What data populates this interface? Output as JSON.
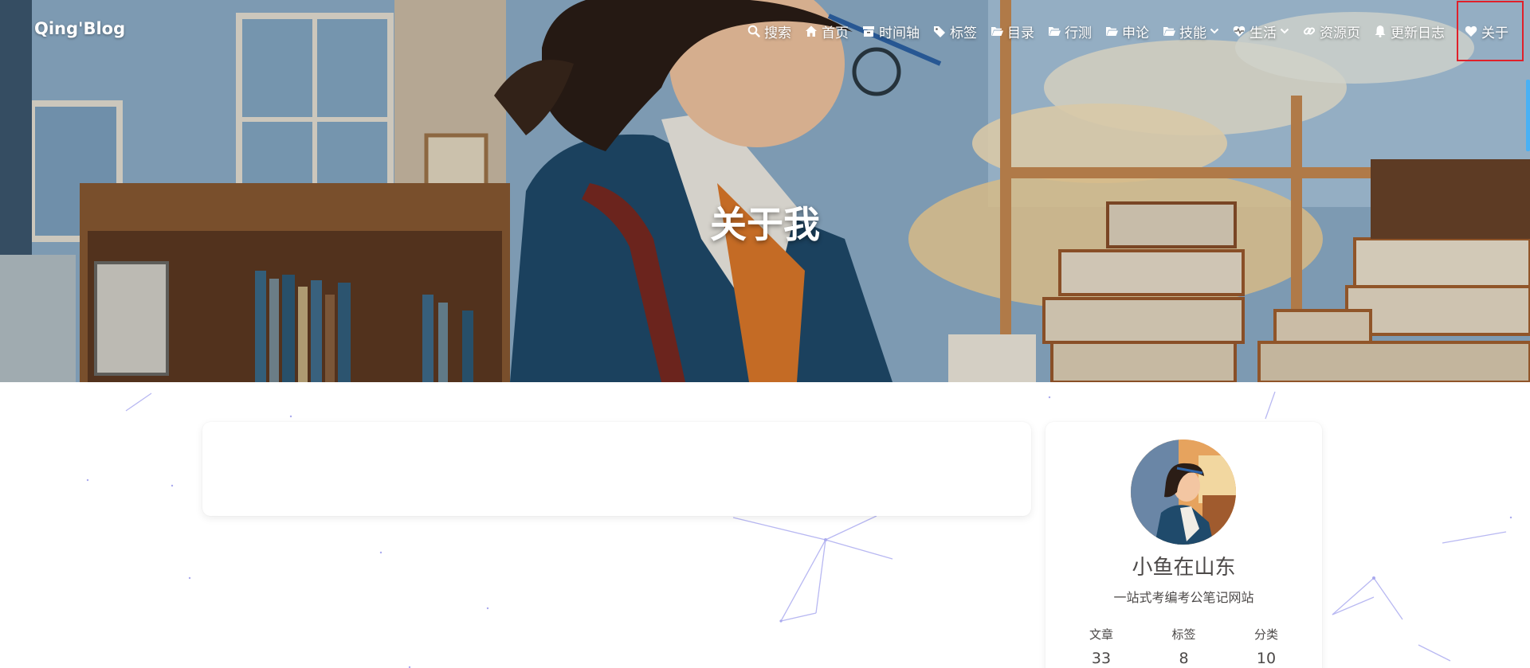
{
  "site": {
    "name": "Qing'Blog"
  },
  "nav": {
    "items": [
      {
        "label": "搜索",
        "icon": "search-icon"
      },
      {
        "label": "首页",
        "icon": "home-icon"
      },
      {
        "label": "时间轴",
        "icon": "archive-icon"
      },
      {
        "label": "标签",
        "icon": "tags-icon"
      },
      {
        "label": "目录",
        "icon": "folder-icon"
      },
      {
        "label": "行测",
        "icon": "folder-icon"
      },
      {
        "label": "申论",
        "icon": "folder-icon"
      },
      {
        "label": "技能",
        "icon": "folder-icon",
        "dropdown": true
      },
      {
        "label": "生活",
        "icon": "heartbeat-icon",
        "dropdown": true
      },
      {
        "label": "资源页",
        "icon": "link-icon"
      },
      {
        "label": "更新日志",
        "icon": "bell-icon"
      },
      {
        "label": "关于",
        "icon": "heart-icon",
        "highlighted": true
      }
    ]
  },
  "hero": {
    "title": "关于我"
  },
  "author": {
    "name": "小鱼在山东",
    "description": "一站式考编考公笔记网站",
    "stats": [
      {
        "label": "文章",
        "value": "33"
      },
      {
        "label": "标签",
        "value": "8"
      },
      {
        "label": "分类",
        "value": "10"
      }
    ]
  },
  "colors": {
    "highlight_box": "#e0202a",
    "accent": "#49b1f5",
    "text": "#4c4948"
  }
}
